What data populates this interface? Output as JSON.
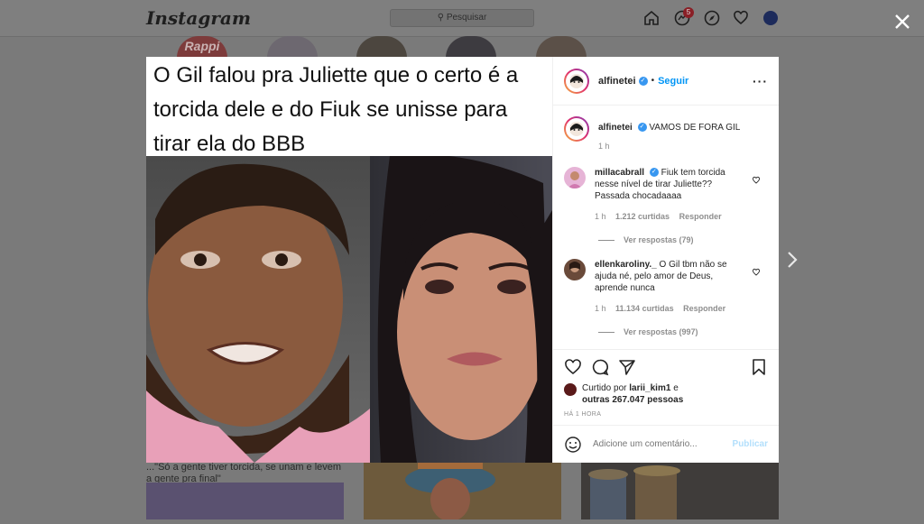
{
  "topbar": {
    "logo": "Instagram",
    "search_placeholder": "Pesquisar",
    "messages_badge": "5"
  },
  "background": {
    "story_text": "Rappi",
    "caption": "...\"Só a gente tiver torcida, se unam e levem a gente pra final\""
  },
  "post": {
    "headline": "O Gil falou pra Juliette que o certo é a torcida dele e do Fiuk se unisse para tirar ela do BBB",
    "author": "alfinetei",
    "follow_label": "Seguir",
    "caption_user": "alfinetei",
    "caption_text": "VAMOS DE FORA GIL",
    "caption_time": "1 h",
    "comments": [
      {
        "user": "millacabrall",
        "text": "Fiuk tem torcida nesse nível de tirar Juliette?? Passada chocadaaaa",
        "time": "1 h",
        "likes": "1.212 curtidas",
        "reply_label": "Responder",
        "view_replies": "Ver respostas (79)"
      },
      {
        "user": "ellenkaroliny._",
        "text": "O Gil tbm não se ajuda né, pelo amor de Deus, aprende nunca",
        "time": "1 h",
        "likes": "11.134 curtidas",
        "reply_label": "Responder",
        "view_replies": "Ver respostas (997)"
      }
    ],
    "liked_by_prefix": "Curtido por",
    "liked_by_user": "larii_kim1",
    "liked_by_mid": "e",
    "liked_by_others": "outras 267.047 pessoas",
    "posted_ago": "HÁ 1 HORA",
    "comment_placeholder": "Adicione um comentário...",
    "publish_label": "Publicar"
  },
  "colors": {
    "accent": "#0095f6",
    "publish_disabled": "#b2dffc",
    "overlay": "#7a7a7a"
  }
}
